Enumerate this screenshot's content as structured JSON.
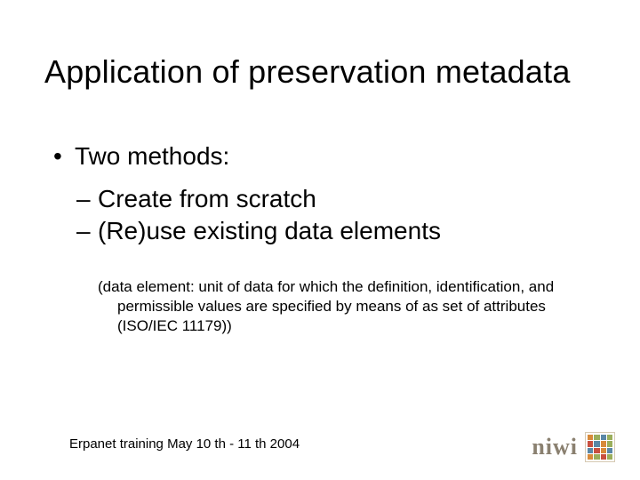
{
  "title": "Application of preservation metadata",
  "bullets": {
    "main": "Two methods:",
    "sub1": "Create from scratch",
    "sub2": "(Re)use existing data elements"
  },
  "note": "(data element: unit of data for which the definition, identification, and permissible values are specified by means of as set of attributes (ISO/IEC 11179))",
  "footer": "Erpanet training May 10 th - 11 th 2004",
  "logo_text": "niwi"
}
